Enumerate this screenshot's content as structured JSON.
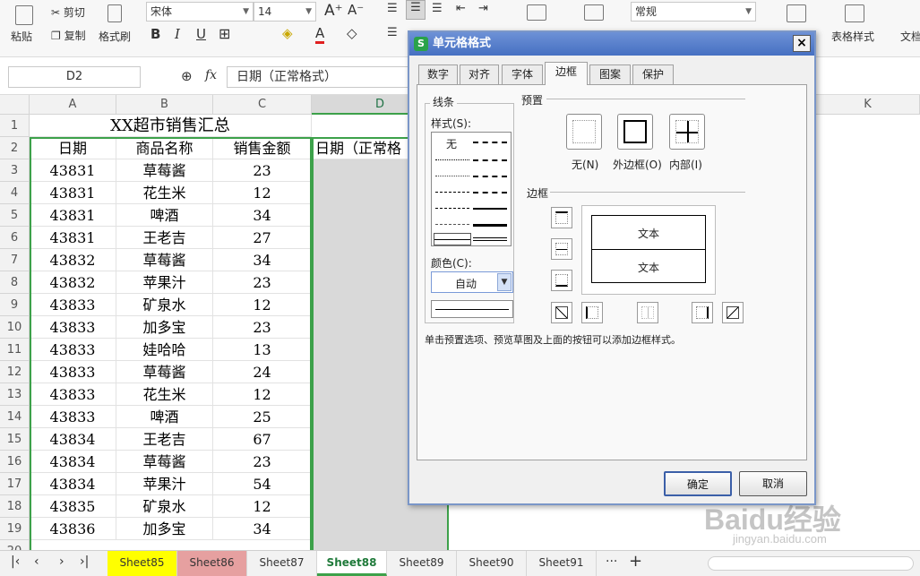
{
  "ribbon": {
    "paste": "粘贴",
    "cut": "剪切",
    "copy": "复制",
    "format_painter": "格式刷",
    "font_name": "宋体",
    "font_size": "14",
    "number_format": "常规",
    "table_style": "表格样式",
    "text_tools": "文档"
  },
  "formula_bar": {
    "name_box": "D2",
    "fx": "fx",
    "value": "日期（正常格式）"
  },
  "columns": [
    "A",
    "B",
    "C",
    "D",
    "K"
  ],
  "sheet": {
    "title": "XX超市销售汇总",
    "headers": [
      "日期",
      "商品名称",
      "销售金额",
      "日期（正常格"
    ],
    "rows": [
      [
        "43831",
        "草莓酱",
        "23"
      ],
      [
        "43831",
        "花生米",
        "12"
      ],
      [
        "43831",
        "啤酒",
        "34"
      ],
      [
        "43831",
        "王老吉",
        "27"
      ],
      [
        "43832",
        "草莓酱",
        "34"
      ],
      [
        "43832",
        "苹果汁",
        "23"
      ],
      [
        "43833",
        "矿泉水",
        "12"
      ],
      [
        "43833",
        "加多宝",
        "23"
      ],
      [
        "43833",
        "娃哈哈",
        "13"
      ],
      [
        "43833",
        "草莓酱",
        "24"
      ],
      [
        "43833",
        "花生米",
        "12"
      ],
      [
        "43833",
        "啤酒",
        "25"
      ],
      [
        "43834",
        "王老吉",
        "67"
      ],
      [
        "43834",
        "草莓酱",
        "23"
      ],
      [
        "43834",
        "苹果汁",
        "54"
      ],
      [
        "43835",
        "矿泉水",
        "12"
      ],
      [
        "43836",
        "加多宝",
        "34"
      ]
    ],
    "row_numbers": [
      "1",
      "2",
      "3",
      "4",
      "5",
      "6",
      "7",
      "8",
      "9",
      "10",
      "11",
      "12",
      "13",
      "14",
      "15",
      "16",
      "17",
      "18",
      "19",
      "20"
    ]
  },
  "tabs": [
    {
      "label": "Sheet85",
      "color": "#ffff00"
    },
    {
      "label": "Sheet86",
      "color": "#e6a0a0"
    },
    {
      "label": "Sheet87",
      "color": "#f2f2f2"
    },
    {
      "label": "Sheet88",
      "color": "#ffffff",
      "active": true
    },
    {
      "label": "Sheet89",
      "color": "#f2f2f2"
    },
    {
      "label": "Sheet90",
      "color": "#f2f2f2"
    },
    {
      "label": "Sheet91",
      "color": "#f2f2f2"
    }
  ],
  "tab_more": "···",
  "tab_add": "+",
  "dialog": {
    "title": "单元格格式",
    "close": "×",
    "tabs": [
      "数字",
      "对齐",
      "字体",
      "边框",
      "图案",
      "保护"
    ],
    "active_tab": "边框",
    "line_group": "线条",
    "style_label": "样式(S):",
    "style_none": "无",
    "color_label": "颜色(C):",
    "color_value": "自动",
    "preset_group": "预置",
    "preset_none": "无(N)",
    "preset_outline": "外边框(O)",
    "preset_inside": "内部(I)",
    "border_group": "边框",
    "preview_text_1": "文本",
    "preview_text_2": "文本",
    "hint": "单击预置选项、预览草图及上面的按钮可以添加边框样式。",
    "ok": "确定",
    "cancel": "取消"
  },
  "watermark": "Baidu经验",
  "watermark_url": "jingyan.baidu.com"
}
